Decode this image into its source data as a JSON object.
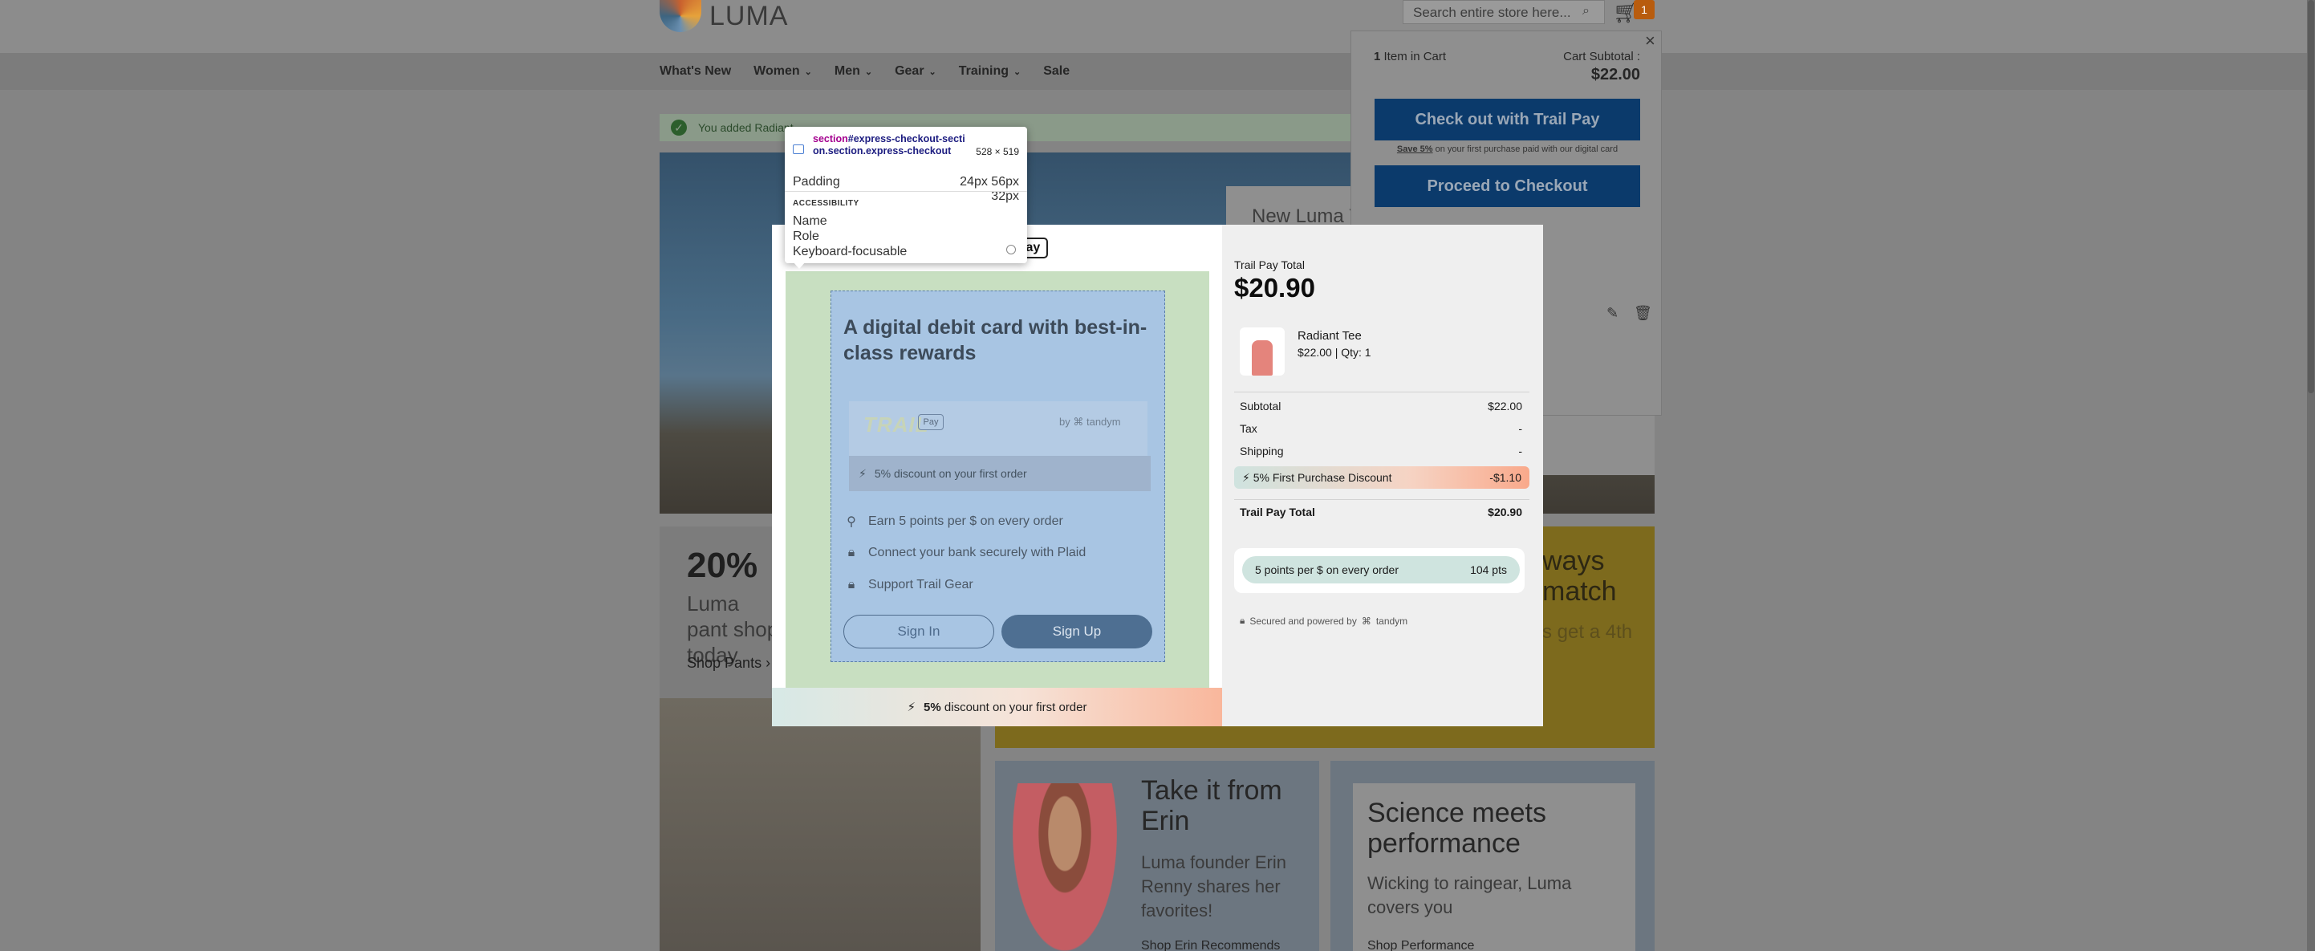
{
  "site": {
    "logo_text": "LUMA",
    "search_placeholder": "Search entire store here...",
    "cart_count": "1",
    "nav": [
      "What's New",
      "Women",
      "Men",
      "Gear",
      "Training",
      "Sale"
    ],
    "message": "You added Radiant",
    "hero_title": "New Luma Y",
    "promo_title": "20%",
    "promo_sub": "Luma pant shop today",
    "promo_link": "Shop Pants",
    "promo_right_text": "ways match",
    "promo_right_sub": "s get a 4th",
    "erin_title": "Take it from Erin",
    "erin_sub": "Luma founder Erin Renny shares her favorites!",
    "erin_link": "Shop Erin Recommends",
    "sci_title": "Science meets performance",
    "sci_sub": "Wicking to raingear, Luma covers you",
    "sci_link": "Shop Performance"
  },
  "minicart": {
    "count_num": "1",
    "count_text": "Item in Cart",
    "subtotal_label": "Cart Subtotal :",
    "subtotal_value": "$22.00",
    "trail_button": "Check out with Trail Pay",
    "save_bold": "Save 5%",
    "save_rest": "on your first purchase paid with our digital card",
    "checkout_button": "Proceed to Checkout"
  },
  "modal": {
    "pay_fragment": "Pay",
    "headline": "A digital debit card with best-in-class rewards",
    "brand_logo": "TRAIL",
    "brand_pay": "Pay",
    "brand_by": "by",
    "brand_tandym": "tandym",
    "card_discount_pct": "5%",
    "card_discount_text": "discount on your first order",
    "benefits": [
      {
        "icon": "award-icon",
        "text": "Earn 5 points per $ on every order"
      },
      {
        "icon": "lock-icon",
        "text": "Connect your bank securely with Plaid"
      },
      {
        "icon": "lock-icon",
        "text": "Support Trail Gear"
      }
    ],
    "sign_in": "Sign In",
    "sign_up": "Sign Up",
    "banner_pct": "5%",
    "banner_text": "discount on your first order"
  },
  "summary": {
    "total_label": "Trail Pay Total",
    "total_value": "$20.90",
    "item_name": "Radiant Tee",
    "item_price": "$22.00",
    "item_qty": "Qty: 1",
    "rows": [
      {
        "label": "Subtotal",
        "value": "$22.00"
      },
      {
        "label": "Tax",
        "value": "-"
      },
      {
        "label": "Shipping",
        "value": "-"
      }
    ],
    "discount_label": "5% First Purchase Discount",
    "discount_value": "-$1.10",
    "grand_label": "Trail Pay Total",
    "grand_value": "$20.90",
    "points_text": "5 points per $ on every order",
    "points_value": "104 pts",
    "secured_text": "Secured and powered by",
    "secured_brand": "tandym"
  },
  "devtools": {
    "selector_tag": "section",
    "selector_rest": "#express-checkout-section.section.express-checkout",
    "size": "528 × 519",
    "padding_label": "Padding",
    "padding_value": "24px 56px 32px",
    "accessibility": "ACCESSIBILITY",
    "name_label": "Name",
    "role_label": "Role",
    "kf_label": "Keyboard-focusable"
  },
  "colors": {
    "brand_navy": "#0b3a6b",
    "highlight_content": "#a8c5e3",
    "highlight_padding": "#c8dfc1",
    "overlay": "#848484"
  }
}
